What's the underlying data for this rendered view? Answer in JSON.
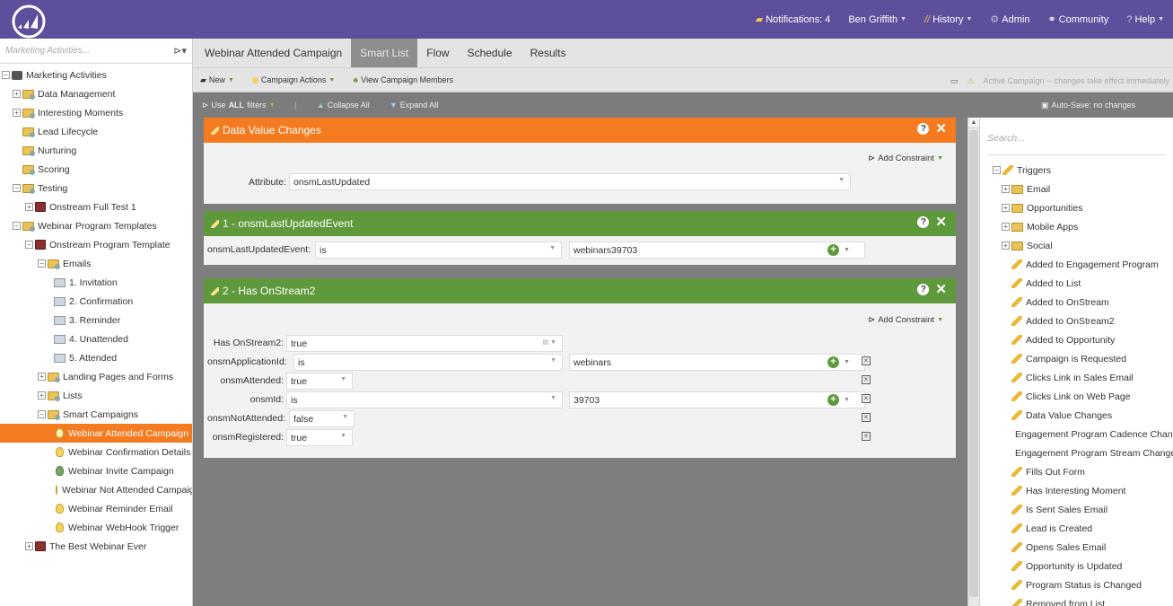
{
  "topnav": {
    "notifications": "Notifications: 4",
    "user": "Ben Griffith",
    "history": "History",
    "admin": "Admin",
    "community": "Community",
    "help": "Help"
  },
  "sidebar": {
    "search_placeholder": "Marketing Activities...",
    "tree": [
      {
        "label": "Marketing Activities"
      },
      {
        "label": "Data Management"
      },
      {
        "label": "Interesting Moments"
      },
      {
        "label": "Lead Lifecycle"
      },
      {
        "label": "Nurturing"
      },
      {
        "label": "Scoring"
      },
      {
        "label": "Testing"
      },
      {
        "label": "Onstream Full Test 1"
      },
      {
        "label": "Webinar Program Templates"
      },
      {
        "label": "Onstream Program Template"
      },
      {
        "label": "Emails"
      },
      {
        "label": "1. Invitation"
      },
      {
        "label": "2. Confirmation"
      },
      {
        "label": "3. Reminder"
      },
      {
        "label": "4. Unattended"
      },
      {
        "label": "5. Attended"
      },
      {
        "label": "Landing Pages and Forms"
      },
      {
        "label": "Lists"
      },
      {
        "label": "Smart Campaigns"
      },
      {
        "label": "Webinar Attended Campaign"
      },
      {
        "label": "Webinar Confirmation Details"
      },
      {
        "label": "Webinar Invite Campaign"
      },
      {
        "label": "Webinar Not Attended Campaign"
      },
      {
        "label": "Webinar Reminder Email"
      },
      {
        "label": "Webinar WebHook Trigger"
      },
      {
        "label": "The Best Webinar Ever"
      }
    ]
  },
  "tabs": [
    "Webinar Attended Campaign",
    "Smart List",
    "Flow",
    "Schedule",
    "Results"
  ],
  "toolbar": {
    "new": "New",
    "campaign_actions": "Campaign Actions",
    "view_members": "View Campaign Members",
    "status": "Active Campaign -- changes take effect immediately"
  },
  "subbar": {
    "use": "Use",
    "all": "ALL",
    "filters": "filters",
    "collapse": "Collapse All",
    "expand": "Expand All",
    "autosave": "Auto-Save: no changes"
  },
  "card1": {
    "title": "Data Value Changes",
    "add_constraint": "Add Constraint",
    "attribute_label": "Attribute:",
    "attribute_value": "onsmLastUpdated"
  },
  "card2": {
    "title": "1 - onsmLastUpdatedEvent",
    "field_label": "onsmLastUpdatedEvent:",
    "operator": "is",
    "value": "webinars39703"
  },
  "card3": {
    "title": "2 - Has OnStream2",
    "add_constraint": "Add Constraint",
    "rows": [
      {
        "label": "Has OnStream2:",
        "value": "true"
      },
      {
        "label": "onsmApplicationId:",
        "operator": "is",
        "value": "webinars"
      },
      {
        "label": "onsmAttended:",
        "value": "true"
      },
      {
        "label": "onsmId:",
        "operator": "is",
        "value": "39703"
      },
      {
        "label": "onsmNotAttended:",
        "value": "false"
      },
      {
        "label": "onsmRegistered:",
        "value": "true"
      }
    ]
  },
  "rpanel": {
    "search_placeholder": "Search...",
    "tree": [
      "Triggers",
      "Email",
      "Opportunities",
      "Mobile Apps",
      "Social",
      "Added to Engagement Program",
      "Added to List",
      "Added to OnStream",
      "Added to OnStream2",
      "Added to Opportunity",
      "Campaign is Requested",
      "Clicks Link in Sales Email",
      "Clicks Link on Web Page",
      "Data Value Changes",
      "Engagement Program Cadence Changes",
      "Engagement Program Stream Changes",
      "Fills Out Form",
      "Has Interesting Moment",
      "Is Sent Sales Email",
      "Lead is Created",
      "Opens Sales Email",
      "Opportunity is Updated",
      "Program Status is Changed",
      "Removed from List"
    ]
  }
}
